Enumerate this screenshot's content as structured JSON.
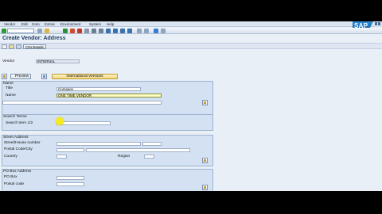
{
  "menubar": {
    "items": [
      "Vendor",
      "Edit",
      "Goto",
      "Extras",
      "Environment",
      "System",
      "Help"
    ]
  },
  "logo": {
    "text": "SAP"
  },
  "screen": {
    "title": "Create Vendor: Address"
  },
  "vendor": {
    "label": "Vendor",
    "value": "INTERNAL",
    "cin_button": "CIN Details"
  },
  "toolbar": {
    "preview_label": "Preview",
    "intl_versions_label": "International Versions"
  },
  "name_group": {
    "title": "Name",
    "title_label": "Title",
    "title_value": "Company",
    "name_label": "Name",
    "name_value": "ONE TIME VENDOR"
  },
  "search_terms": {
    "title": "Search Terms",
    "label": "Search term 1/2",
    "value": ""
  },
  "street_address": {
    "title": "Street Address",
    "street_label": "Street/House number",
    "postal_label": "Postal Code/City",
    "country_label": "Country",
    "region_label": "Region"
  },
  "po_box": {
    "title": "PO Box Address",
    "po_box_label": "PO Box",
    "postal_label": "Postal code"
  },
  "colors": {
    "background": "#e9eff7",
    "group": "#d3e1f2",
    "highlight_field": "#ffffc2",
    "title": "#1f3a5f"
  }
}
